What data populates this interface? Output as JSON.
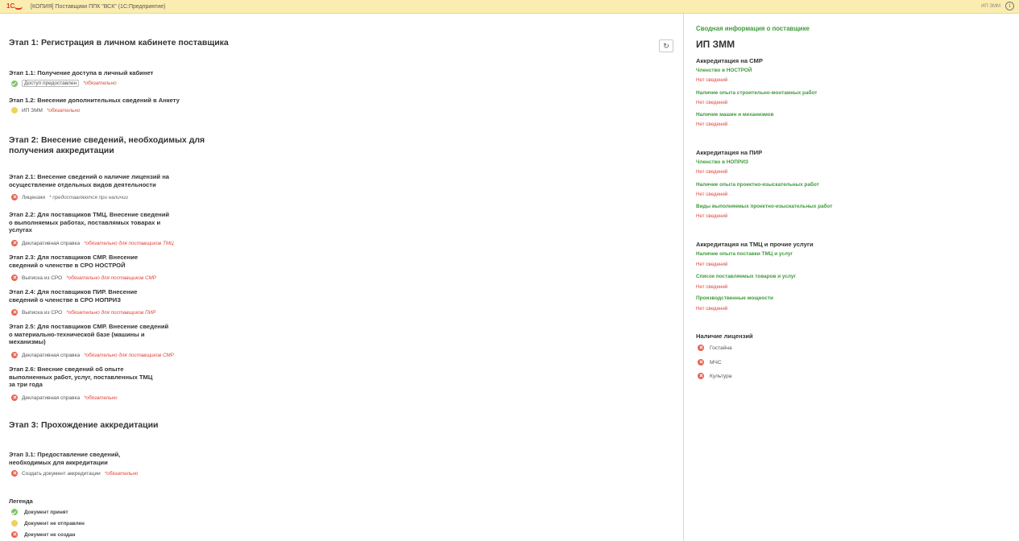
{
  "window": {
    "logo_text": "1С",
    "title": "[КОПИЯ] Поставщики ППК \"ВСК\"  (1С:Предприятие)",
    "user": "ИП ЗММ"
  },
  "colors": {
    "accent_green": "#3f9a3a",
    "required_red": "#e0463a",
    "titlebar_bg": "#fbedb0",
    "status_green": "#7ec667",
    "status_yellow": "#f2d05a",
    "status_red": "#e8604c"
  },
  "icons": {
    "refresh": "↻",
    "info": "i"
  },
  "stage1": {
    "title": "Этап 1: Регистрация в личном кабинете поставщика",
    "s1_1": {
      "title": "Этап 1.1: Получение доступа в личный кабинет",
      "status": "Доступ предоставлен",
      "note": "*обязательно"
    },
    "s1_2": {
      "title": "Этап 1.2: Внесение дополнительных сведений в Анкету",
      "status": "ИП ЗММ",
      "note": "*обязательно"
    }
  },
  "stage2": {
    "title_lines": [
      "Этап 2: Внесение сведений, необходимых для",
      "получения аккредитации"
    ],
    "s2_1": {
      "title_lines": [
        "Этап 2.1: Внесение сведений о наличие лицензий на",
        "осуществление отдельных видов деятельности"
      ],
      "status": "Лицензии",
      "note": "* предоставляются при наличии"
    },
    "s2_2": {
      "title_lines": [
        "Этап 2.2: Для поставщиков ТМЦ. Внесение сведений",
        "о выполняемых работах, поставлямых товарах и",
        "услугах"
      ],
      "status": "Декларативная справка",
      "note": "*обязательно для поставщиков ТМЦ"
    },
    "s2_3": {
      "title_lines": [
        "Этап 2.3: Для поставщиков СМР. Внесение",
        "сведений о членстве в СРО НОСТРОЙ"
      ],
      "status": "Выписка из СРО",
      "note": "*обязательно для поставщиков СМР"
    },
    "s2_4": {
      "title_lines": [
        "Этап 2.4: Для поставщиков ПИР. Внесение",
        "сведений о членстве в СРО НОПРИЗ"
      ],
      "status": "Выписка из СРО",
      "note": "*обязательно для поставщиков ПИР"
    },
    "s2_5": {
      "title_lines": [
        "Этап 2.5: Для поставщиков СМР. Внесение  сведений",
        "о материально-технической базе (машины и",
        "механизмы)"
      ],
      "status": "Декларативная справка",
      "note": "*обязательно для поставщиков СМР"
    },
    "s2_6": {
      "title_lines": [
        "Этап 2.6: Внесние сведений об опыте",
        "выполненных работ, услуг, поставленных ТМЦ",
        "за три года"
      ],
      "status": "Декларативная справка",
      "note": "*обязательно"
    }
  },
  "stage3": {
    "title": "Этап 3: Прохождение аккредитации",
    "s3_1": {
      "title_lines": [
        "Этап 3.1: Предоставление сведений,",
        "необходимых для аккредитации"
      ],
      "status": "Создать документ аккредитации",
      "note": "*обязательно"
    }
  },
  "legend": {
    "title": "Легенда",
    "accepted": "Документ принят",
    "not_sent": "Документ не отправлен",
    "not_created": "Документ не создан"
  },
  "summary": {
    "title": "Сводная информация о поставщике",
    "supplier": "ИП ЗММ",
    "smr": {
      "heading": "Аккредитация на СМР",
      "items": [
        {
          "label": "Членство в НОСТРОЙ",
          "value": "Нет сведений"
        },
        {
          "label": "Наличие опыта строительно-монтажных работ",
          "value": "Нет сведений"
        },
        {
          "label": "Наличие машин и механизмов",
          "value": "Нет сведений"
        }
      ]
    },
    "pir": {
      "heading": "Аккредитация на ПИР",
      "items": [
        {
          "label": "Членство в НОПРИЗ",
          "value": "Нет сведений"
        },
        {
          "label": "Наличие опыта проектно-изыскательных работ",
          "value": "Нет сведений"
        },
        {
          "label": "Виды выполняемых проектно-изыскательных работ",
          "value": "Нет сведений"
        }
      ]
    },
    "tmc": {
      "heading": "Аккредитация на ТМЦ и прочие услуги",
      "items": [
        {
          "label": "Наличие опыта поставки ТМЦ и услуг",
          "value": "Нет сведений"
        },
        {
          "label": "Список поставляемых товаров и услуг",
          "value": "Нет сведений"
        },
        {
          "label": "Производственные мощности",
          "value": "Нет сведений"
        }
      ]
    },
    "licenses": {
      "heading": "Наличие лицензий",
      "items": [
        "Гостайна",
        "МЧС",
        "Культура"
      ]
    }
  }
}
